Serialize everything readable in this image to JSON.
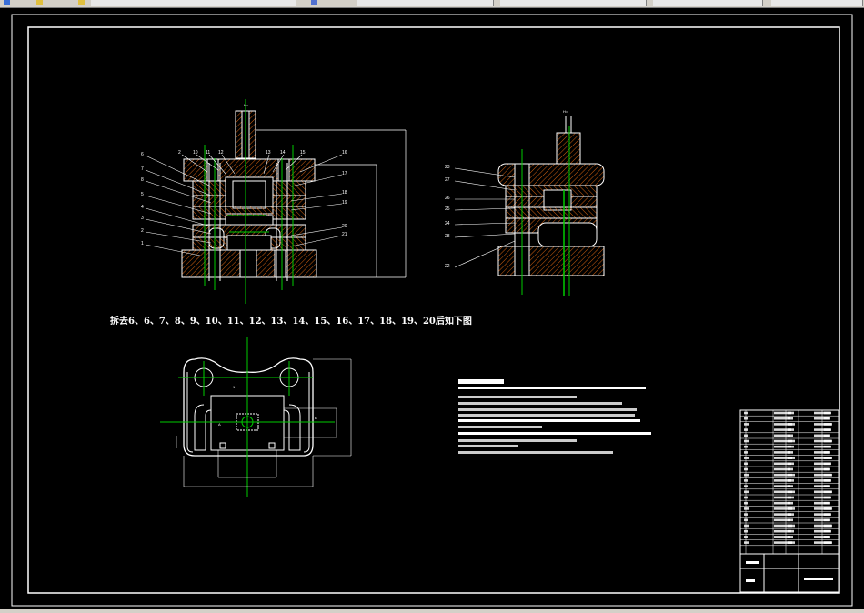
{
  "caption": "拆去6、6、7、8、9、10、11、12、13、14、15、16、17、18、19、20后如下图",
  "colors": {
    "background": "#000000",
    "line": "#ffffff",
    "centerline": "#00cc00",
    "hatch": "#d06010",
    "dimension": "#ffffff",
    "toolbar": "#d4d0c8"
  },
  "icons": [
    "drawing-file-icon",
    "layer-icon",
    "properties-icon"
  ],
  "front_view": {
    "left_labels": [
      "6",
      "7",
      "8",
      "5",
      "4",
      "3",
      "2",
      "1"
    ],
    "top_labels": [
      "2",
      "10",
      "11",
      "12",
      "13",
      "14",
      "15",
      "16"
    ],
    "right_labels": [
      "17",
      "18",
      "19",
      "20",
      "21"
    ]
  },
  "side_view": {
    "left_labels": [
      "23",
      "27",
      "26",
      "25",
      "24",
      "28",
      "22"
    ]
  }
}
